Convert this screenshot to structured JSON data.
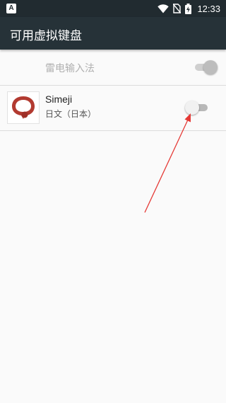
{
  "status_bar": {
    "time": "12:33",
    "left_icon": "notification-a-icon",
    "icons": [
      "wifi-icon",
      "no-sim-icon",
      "battery-charging-icon"
    ]
  },
  "app_bar": {
    "title": "可用虚拟键盘"
  },
  "keyboards": [
    {
      "name": "雷电输入法",
      "enabled": true,
      "disabled_state": true
    },
    {
      "name": "Simeji",
      "subtitle": "日文（日本）",
      "icon": "simeji-logo-icon",
      "enabled": false
    }
  ],
  "annotation": {
    "type": "red-arrow",
    "color": "#e53935",
    "points_to": "simeji-toggle"
  },
  "colors": {
    "status_bar": "#212b30",
    "app_bar": "#263238",
    "background": "#fafafa",
    "simeji_red": "#b23a30"
  }
}
